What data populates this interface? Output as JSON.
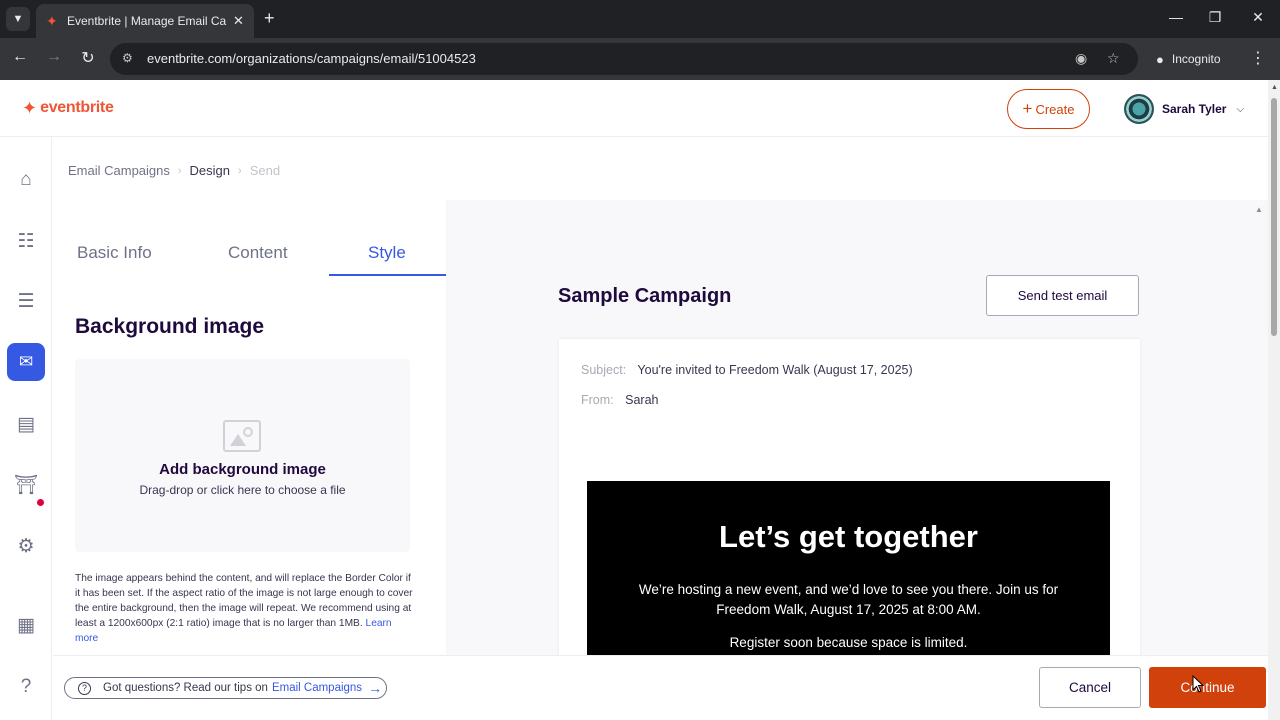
{
  "browser": {
    "tab_title": "Eventbrite | Manage Email Campaigns",
    "url": "eventbrite.com/organizations/campaigns/email/51004523",
    "incognito_label": "Incognito"
  },
  "header": {
    "logo_text": "eventbrite",
    "create_label": "Create",
    "user_name": "Sarah Tyler"
  },
  "breadcrumb": {
    "items": [
      "Email Campaigns",
      "Design",
      "Send"
    ]
  },
  "panel": {
    "tabs": [
      "Basic Info",
      "Content",
      "Style"
    ],
    "active_tab": "Style",
    "section_title": "Background image",
    "dropzone_title": "Add background image",
    "dropzone_subtitle": "Drag-drop or click here to choose a file",
    "help_text": "The image appears behind the content, and will replace the Border Color if it has been set. If the aspect ratio of the image is not large enough to cover the entire background, then the image will repeat. We recommend using at least a 1200x600px (2:1 ratio) image that is no larger than 1MB.",
    "learn_more": "Learn more"
  },
  "preview": {
    "campaign_title": "Sample Campaign",
    "send_test_label": "Send test email",
    "subject_label": "Subject:",
    "subject_value": "You're invited to Freedom Walk (August 17, 2025)",
    "from_label": "From:",
    "from_value": "Sarah",
    "hero_title": "Let’s get together",
    "hero_text": "We’re hosting a new event, and we’d love to see you there. Join us for Freedom Walk, August 17, 2025 at 8:00 AM.",
    "hero_text2": "Register soon because space is limited."
  },
  "footer": {
    "tips_text": "Got questions? Read our tips on",
    "tips_link": "Email Campaigns",
    "cancel_label": "Cancel",
    "continue_label": "Continue"
  },
  "colors": {
    "brand": "#f05537",
    "primary_button": "#d1410c",
    "accent": "#3659e3"
  }
}
